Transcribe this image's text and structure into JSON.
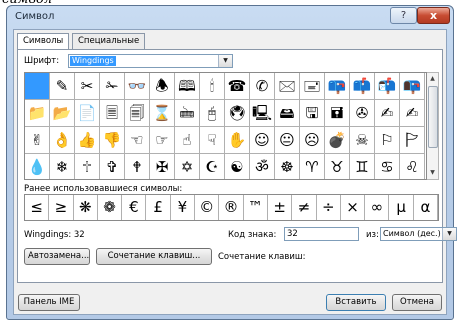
{
  "window": {
    "title": "Символ",
    "help_label": "?",
    "close_label": "x"
  },
  "tabs": [
    {
      "label": "Символы",
      "active": true
    },
    {
      "label": "Специальные знаки",
      "active": false
    }
  ],
  "font": {
    "label": "Шрифт:",
    "value": "Wingdings"
  },
  "symbols": [
    [
      "",
      "✎",
      "✂",
      "✁",
      "👓",
      "🕭",
      "🕮",
      "🕯",
      "☎",
      "✆",
      "🖂",
      "🖃",
      "📪",
      "📫",
      "📬",
      "📭"
    ],
    [
      "📁",
      "📂",
      "📄",
      "🗏",
      "🗐",
      "⌛",
      "🖮",
      "🖰",
      "🖲",
      "🖳",
      "🖴",
      "🖫",
      "🖬",
      "✇",
      "✍",
      "✍"
    ],
    [
      "✌",
      "👌",
      "👍",
      "👎",
      "☜",
      "☞",
      "☝",
      "☟",
      "✋",
      "☺",
      "😐",
      "☹",
      "💣",
      "☠",
      "⚐",
      "🏱"
    ],
    [
      "💧",
      "❄",
      "🕆",
      "✞",
      "🕈",
      "✠",
      "✡",
      "☪",
      "☯",
      "ॐ",
      "☸",
      "♈",
      "♉",
      "♊",
      "♋",
      "♌"
    ]
  ],
  "recent": {
    "label": "Ранее использовавшиеся символы:",
    "items": [
      "≤",
      "≥",
      "❋",
      "❁",
      "€",
      "£",
      "¥",
      "©",
      "®",
      "™",
      "±",
      "≠",
      "÷",
      "×",
      "∞",
      "µ",
      "α"
    ]
  },
  "info": {
    "name": "Wingdings: 32",
    "code_label": "Код знака:",
    "code_value": "32",
    "from_label": "из:",
    "from_value": "Символ (дес.)"
  },
  "buttons": {
    "autocorrect": "Автозамена...",
    "shortcut_key": "Сочетание клавиш...",
    "shortcut_text": "Сочетание клавиш:",
    "ime": "Панель IME",
    "insert": "Вставить",
    "cancel": "Отмена"
  }
}
